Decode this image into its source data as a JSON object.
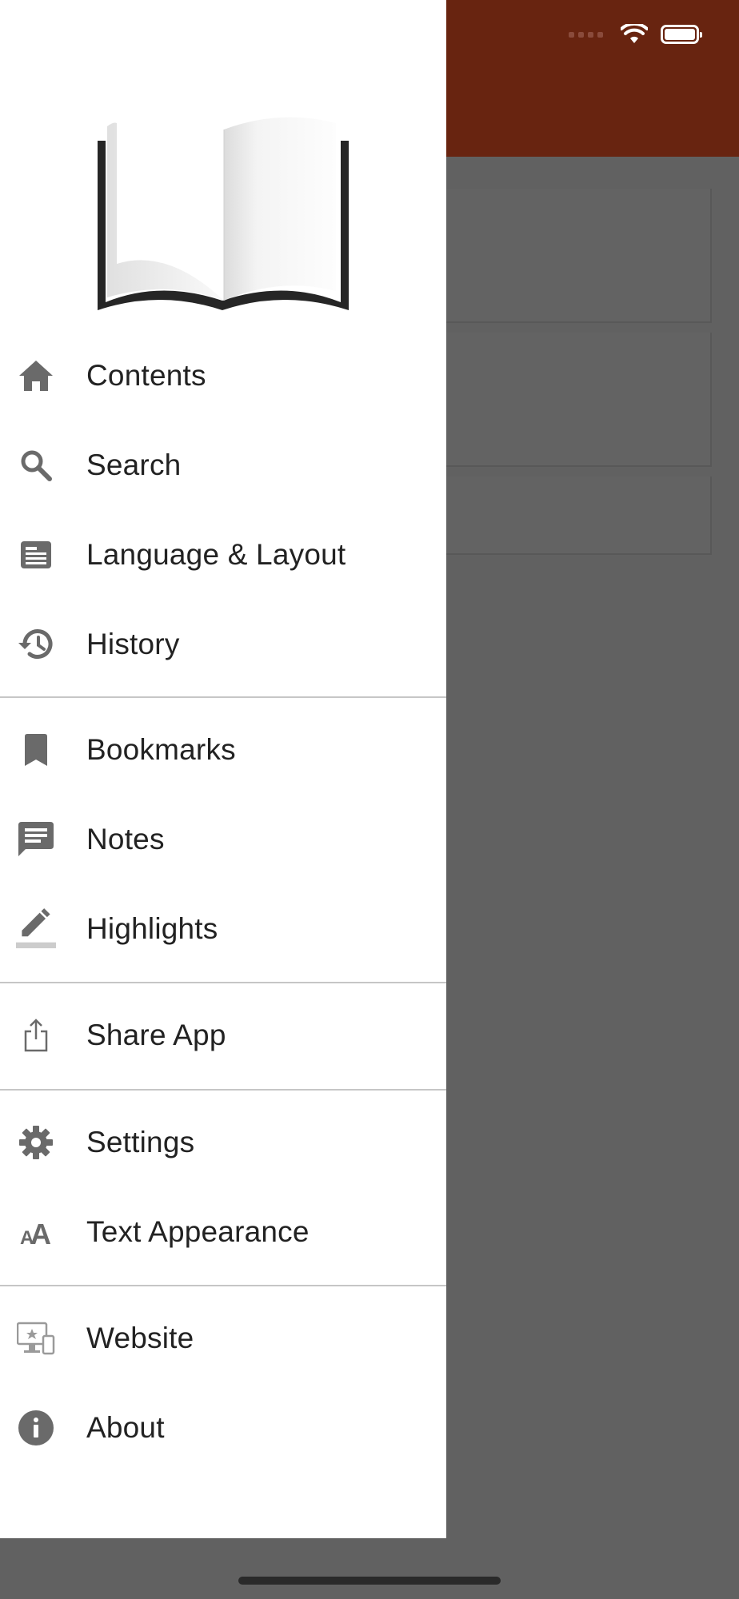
{
  "menu": {
    "contents": "Contents",
    "search": "Search",
    "language_layout": "Language & Layout",
    "history": "History",
    "bookmarks": "Bookmarks",
    "notes": "Notes",
    "highlights": "Highlights",
    "share_app": "Share App",
    "settings": "Settings",
    "text_appearance": "Text Appearance",
    "website": "Website",
    "about": "About"
  },
  "colors": {
    "header": "#682410",
    "overlay": "#616161",
    "drawer": "#ffffff",
    "icon": "#6a6a6a",
    "text": "#222222"
  }
}
